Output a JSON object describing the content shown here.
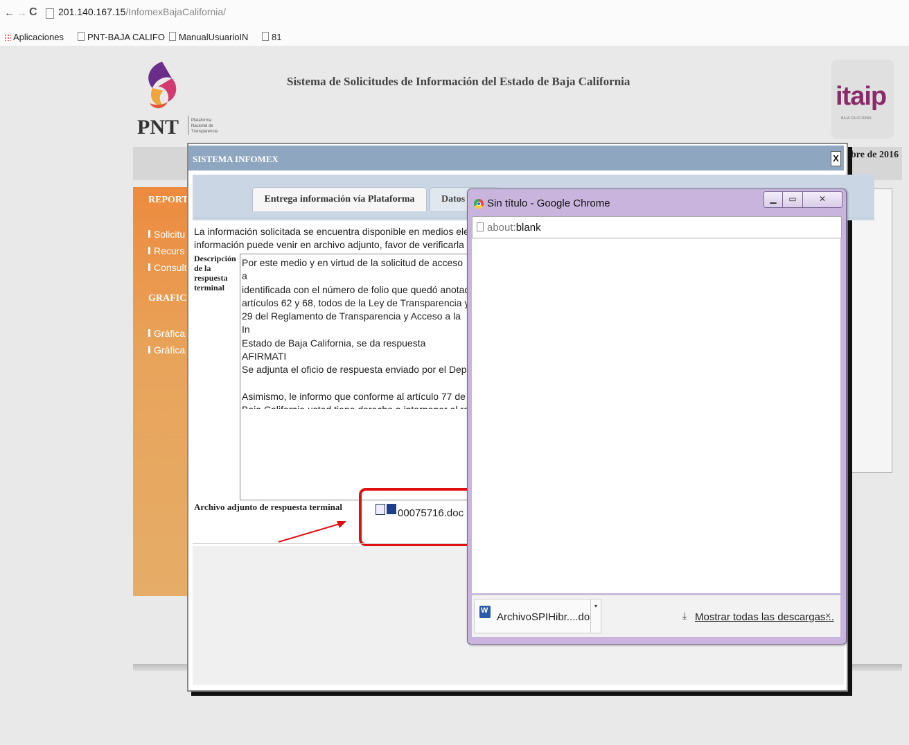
{
  "browser": {
    "address": "201.140.167.15",
    "address_path": "/InfomexBajaCalifornia/",
    "bookmarks": [
      "Aplicaciones",
      "PNT-BAJA CALIFO",
      "ManualUsuarioIN",
      "81"
    ]
  },
  "page": {
    "title": "Sistema de Solicitudes de Información del Estado de Baja California",
    "pnt_logo_text": "PNT",
    "pnt_logo_sub": "Plataforma Nacional de Transparencia",
    "itaip_logo_text": "itaip",
    "itaip_logo_sub": "BAJA CALIFORNIA",
    "date_fragment": "bre de 2016",
    "sidebar": {
      "heading_1": "REPORTE",
      "items_1": [
        "Solicitu",
        "Recurs",
        "Consult"
      ],
      "heading_2": "GRAFICA",
      "items_2": [
        "Gráfica",
        "Gráfica"
      ]
    }
  },
  "modal": {
    "title": "SISTEMA INFOMEX",
    "close_label": "X",
    "tabs": [
      "Entrega información vía Plataforma",
      "Datos"
    ],
    "info_message": "La información solicitada se encuentra disponible en medios electrónicos,\ninformación puede venir en archivo adjunto, favor de verificarla",
    "description_label": "Descripción de la respuesta terminal",
    "description_text": "Por este medio y en virtud de la solicitud de acceso a\nidentificada con el número de folio que quedó anotad\nartículos 62 y 68, todos de la Ley de Transparencia y\n29 del Reglamento de Transparencia y Acceso a la In\nEstado de Baja California, se da respuesta AFIRMATI\nSe adjunta el oficio de respuesta enviado por el Dep\n\nAsimismo, le informo que conforme al artículo 77 de\nBaja California usted tiene derecho a interponer el re\ninformación pública de manera directa ante el órgan\nhttp://itaipbc.org.mx/index.php/inicio/recurso_revisi",
    "attachment_label": "Archivo adjunto de respuesta terminal",
    "attachment_file": "00075716.doc",
    "highlight_color": "#e01010"
  },
  "popup": {
    "title": "Sin título - Google Chrome",
    "address_scheme": "about:",
    "address_rest": "blank",
    "download_name": "ArchivoSPIHibr....doc",
    "show_all_label": "Mostrar todas las descargas...",
    "close_label": "×"
  }
}
